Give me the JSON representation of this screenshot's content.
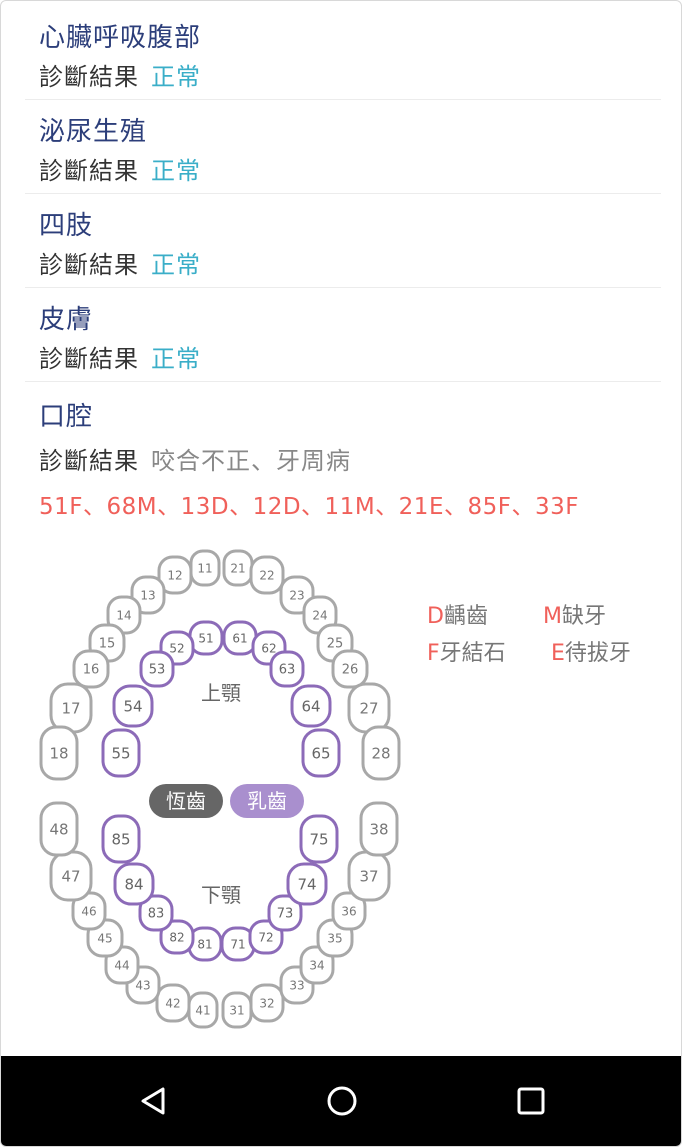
{
  "sections": [
    {
      "title": "心臟呼吸腹部",
      "label": "診斷結果",
      "value": "正常"
    },
    {
      "title": "泌尿生殖",
      "label": "診斷結果",
      "value": "正常"
    },
    {
      "title": "四肢",
      "label": "診斷結果",
      "value": "正常"
    },
    {
      "title": "皮膚",
      "label": "診斷結果",
      "value": "正常"
    }
  ],
  "oral": {
    "title": "口腔",
    "label": "診斷結果",
    "value": "咬合不正、牙周病",
    "codes": "51F、68M、13D、12D、11M、21E、85F、33F"
  },
  "legend": {
    "d_key": "D",
    "d_text": "齲齒",
    "m_key": "M",
    "m_text": "缺牙",
    "f_key": "F",
    "f_text": "牙結石",
    "e_key": "E",
    "e_text": "待拔牙"
  },
  "chart": {
    "upper_label": "上顎",
    "lower_label": "下顎",
    "permanent_label": "恆齒",
    "primary_label": "乳齒",
    "permanent_color": "#a8a8a8",
    "primary_color": "#8c6bb8",
    "permanent_teeth": [
      "11",
      "12",
      "13",
      "14",
      "15",
      "16",
      "17",
      "18",
      "21",
      "22",
      "23",
      "24",
      "25",
      "26",
      "27",
      "28",
      "31",
      "32",
      "33",
      "34",
      "35",
      "36",
      "37",
      "38",
      "41",
      "42",
      "43",
      "44",
      "45",
      "46",
      "47",
      "48"
    ],
    "primary_teeth": [
      "51",
      "52",
      "53",
      "54",
      "55",
      "61",
      "62",
      "63",
      "64",
      "65",
      "71",
      "72",
      "73",
      "74",
      "75",
      "81",
      "82",
      "83",
      "84",
      "85"
    ]
  },
  "navbar": {
    "back_icon": "back-triangle-icon",
    "home_icon": "home-circle-icon",
    "recents_icon": "recents-square-icon"
  }
}
